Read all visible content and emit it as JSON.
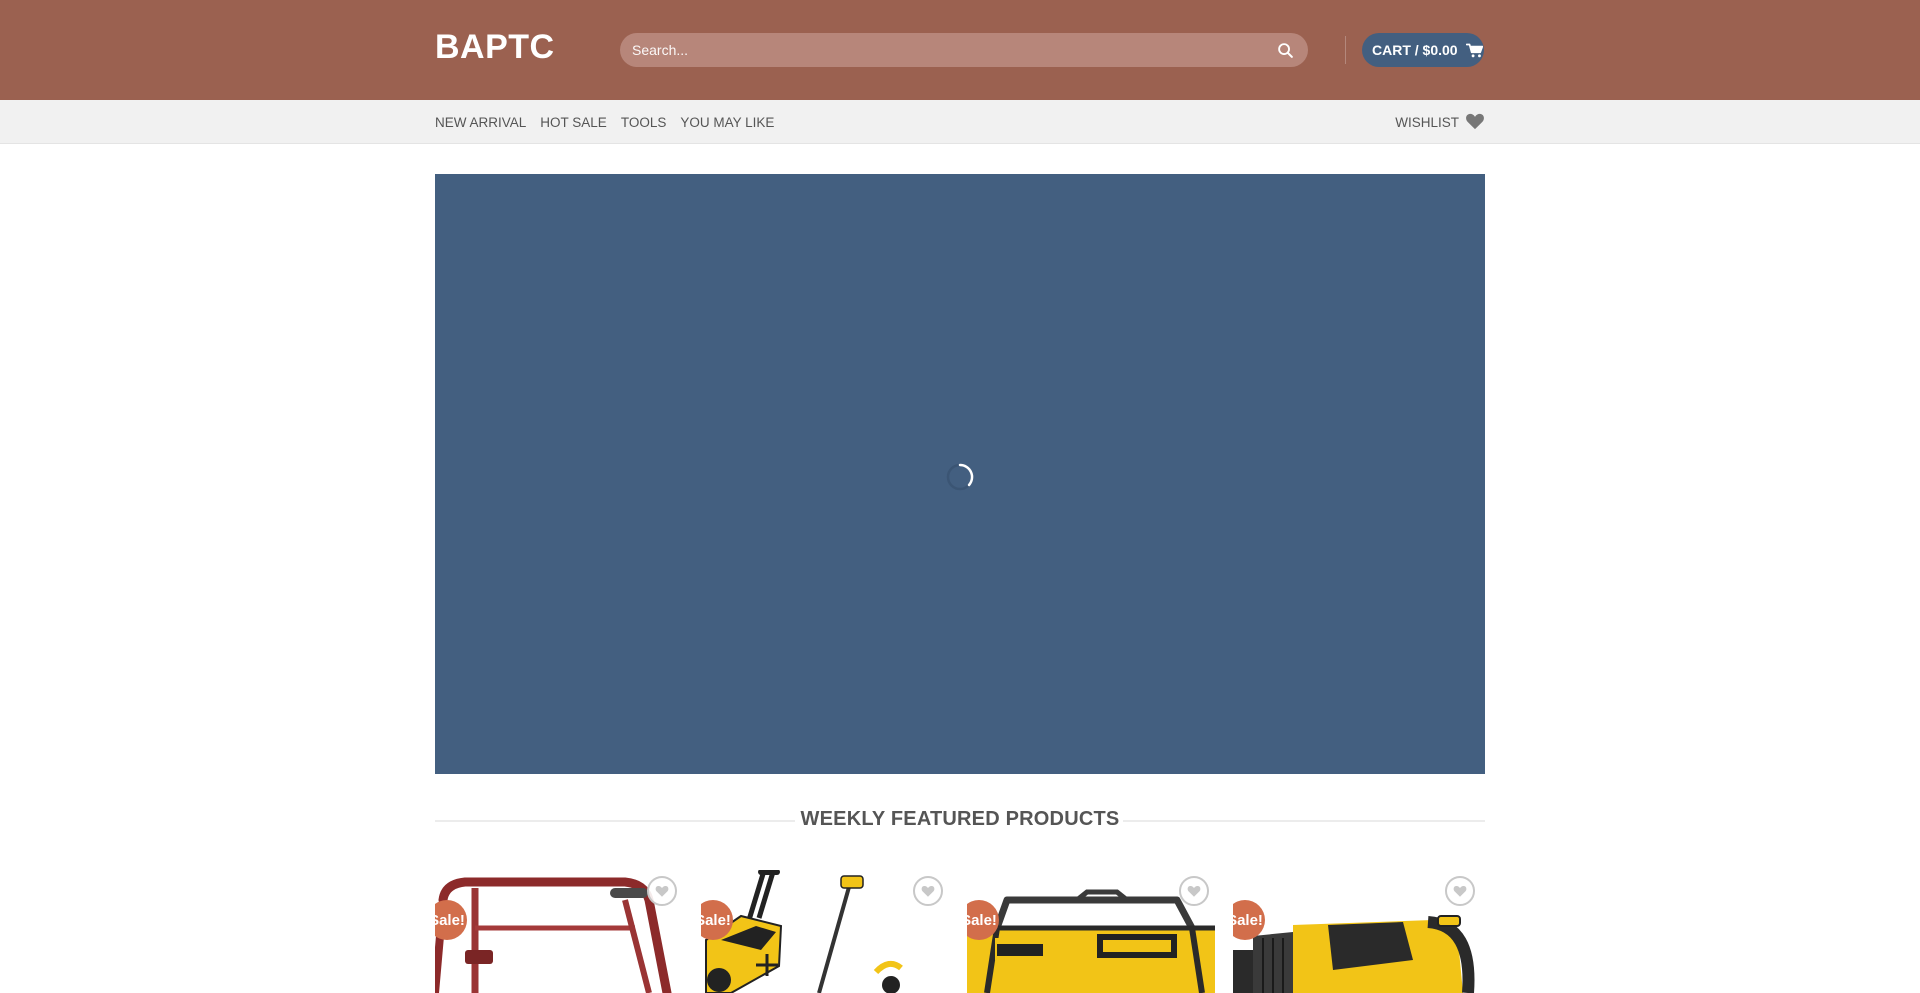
{
  "header": {
    "logo": "BAPTC",
    "search_placeholder": "Search...",
    "cart_label": "CART / $0.00",
    "colors": {
      "header_bg": "#9b6150",
      "cart_bg": "#435f80"
    }
  },
  "nav": {
    "items": [
      {
        "label": "NEW ARRIVAL"
      },
      {
        "label": "HOT SALE"
      },
      {
        "label": "TOOLS"
      },
      {
        "label": "YOU MAY LIKE"
      }
    ],
    "wishlist_label": "WISHLIST"
  },
  "banner": {
    "bg_color": "#435f80",
    "state": "loading"
  },
  "featured": {
    "title": "WEEKLY FEATURED PRODUCTS",
    "products": [
      {
        "badge": "Sale!",
        "image": "red-walker"
      },
      {
        "badge": "Sale!",
        "image": "yellow-lawn-mower-and-trimmer"
      },
      {
        "badge": "Sale!",
        "image": "dewalt-generator"
      },
      {
        "badge": "Sale!",
        "image": "yellow-rotary-hammer"
      }
    ]
  },
  "icons": {
    "search": "search-icon",
    "cart": "cart-icon",
    "wishlist": "heart-icon",
    "loader": "spinner-icon",
    "product_wishlist": "heart-outline-icon"
  }
}
